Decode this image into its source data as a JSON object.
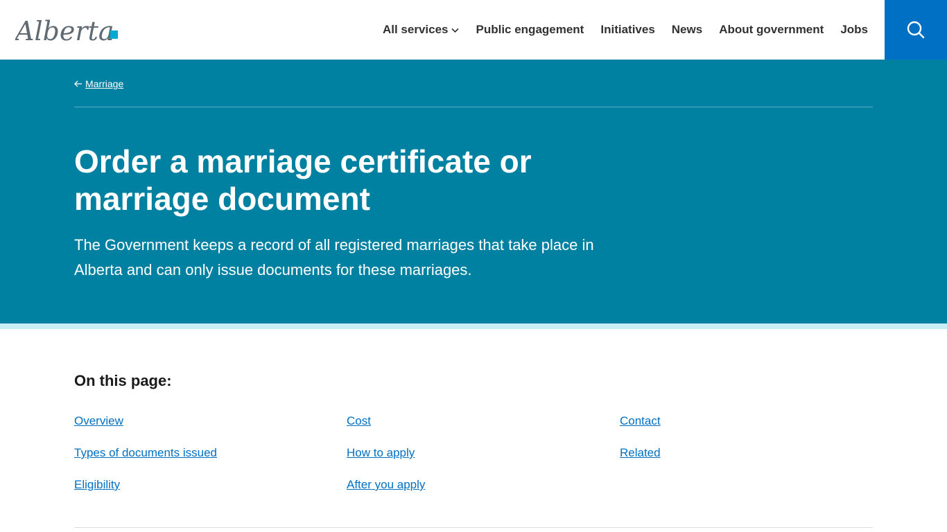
{
  "header": {
    "logo_text": "Alberta",
    "nav": [
      {
        "label": "All services",
        "has_dropdown": true
      },
      {
        "label": "Public engagement"
      },
      {
        "label": "Initiatives"
      },
      {
        "label": "News"
      },
      {
        "label": "About government"
      },
      {
        "label": "Jobs"
      }
    ],
    "search_icon": "search-icon"
  },
  "hero": {
    "breadcrumb_label": "Marriage",
    "title": "Order a marriage certificate or marriage document",
    "lead": "The Government keeps a record of all registered marriages that take place in Alberta and can only issue documents for these marriages."
  },
  "on_this_page": {
    "heading": "On this page:",
    "columns": [
      [
        "Overview",
        "Types of documents issued",
        "Eligibility"
      ],
      [
        "Cost",
        "How to apply",
        "After you apply"
      ],
      [
        "Contact",
        "Related"
      ]
    ]
  },
  "colors": {
    "hero_bg": "#0081a2",
    "hero_stripe": "#c8eef5",
    "search_bg": "#0070c4",
    "link": "#0070c4"
  }
}
